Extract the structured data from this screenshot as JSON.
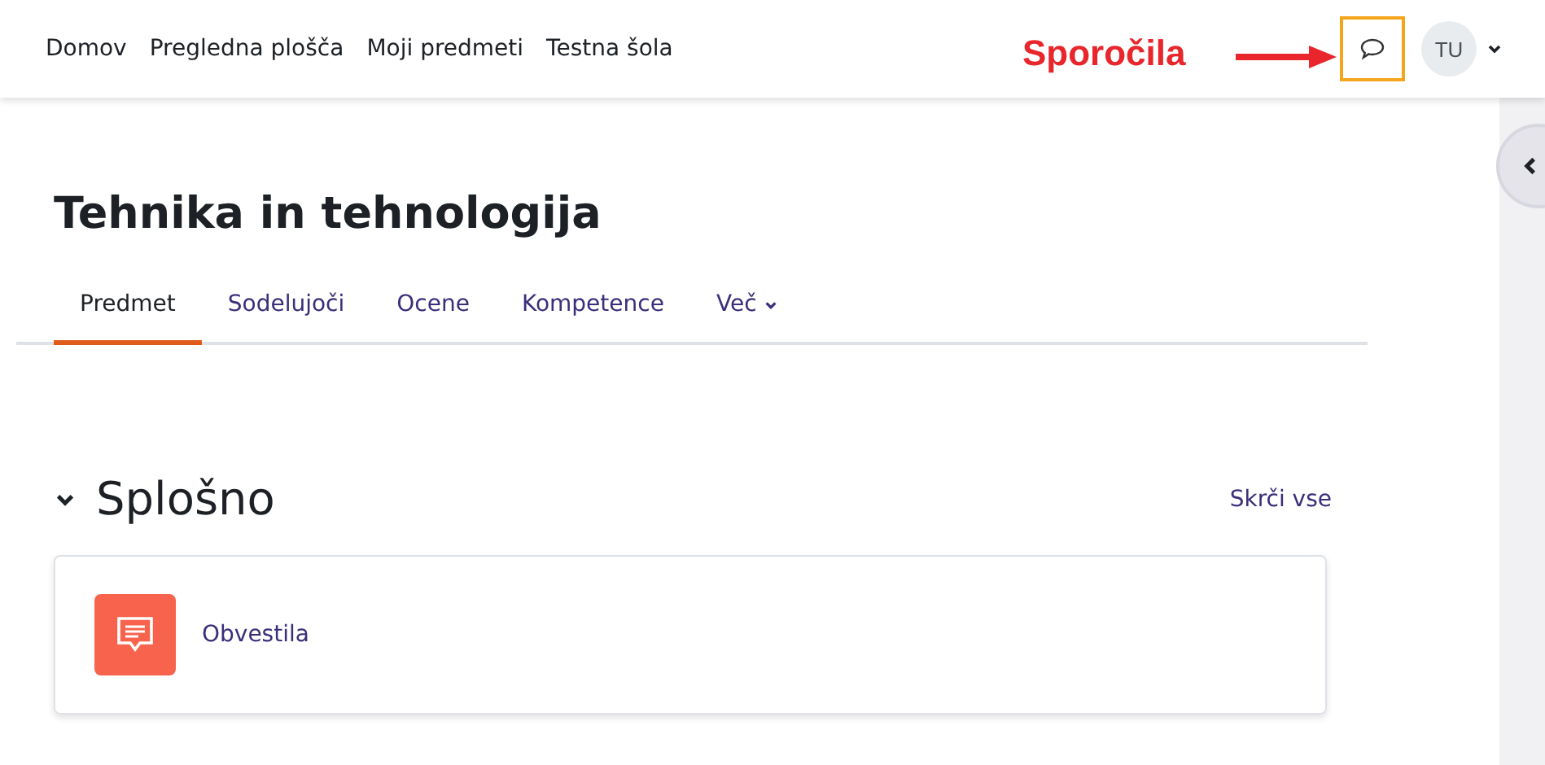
{
  "nav": {
    "links": [
      {
        "label": "Domov"
      },
      {
        "label": "Pregledna plošča"
      },
      {
        "label": "Moji predmeti"
      },
      {
        "label": "Testna šola"
      }
    ],
    "highlighted_messages": true,
    "user_initials": "TU"
  },
  "annotation": {
    "label": "Sporočila"
  },
  "course": {
    "title": "Tehnika in tehnologija"
  },
  "tabs": [
    {
      "label": "Predmet",
      "selected": true,
      "dropdown": false
    },
    {
      "label": "Sodelujoči",
      "selected": false,
      "dropdown": false
    },
    {
      "label": "Ocene",
      "selected": false,
      "dropdown": false
    },
    {
      "label": "Kompetence",
      "selected": false,
      "dropdown": false
    },
    {
      "label": "Več",
      "selected": false,
      "dropdown": true
    }
  ],
  "section": {
    "title": "Splošno",
    "expanded": true,
    "collapse_link": "Skrči vse",
    "activities": [
      {
        "name": "Obvestila",
        "kind": "forum"
      }
    ]
  }
}
